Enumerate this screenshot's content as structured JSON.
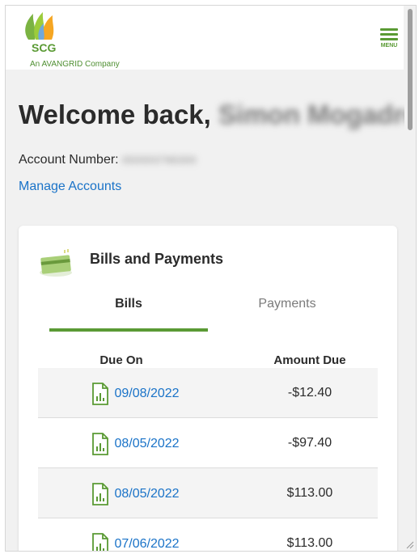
{
  "header": {
    "logo_word": "SCG",
    "logo_tagline": "An AVANGRID Company",
    "menu_label": "MENU"
  },
  "welcome": {
    "greeting": "Welcome back,",
    "name": "Simon Mogadro"
  },
  "account": {
    "label": "Account Number:",
    "number": "050003796300"
  },
  "manage_accounts_label": "Manage Accounts",
  "bills_card": {
    "title": "Bills and Payments",
    "tabs": [
      {
        "label": "Bills",
        "active": true
      },
      {
        "label": "Payments",
        "active": false
      }
    ],
    "columns": {
      "due_on": "Due On",
      "amount_due": "Amount Due"
    },
    "rows": [
      {
        "due": "09/08/2022",
        "amount": "-$12.40"
      },
      {
        "due": "08/05/2022",
        "amount": "-$97.40"
      },
      {
        "due": "08/05/2022",
        "amount": "$113.00"
      },
      {
        "due": "07/06/2022",
        "amount": "$113.00"
      }
    ]
  },
  "colors": {
    "brand_green": "#5a9a34",
    "link_blue": "#1a73c8",
    "background": "#f1f1f1"
  },
  "icons": [
    "scg-flame-logo-icon",
    "menu-hamburger-icon",
    "credit-card-icon",
    "bill-document-icon"
  ]
}
